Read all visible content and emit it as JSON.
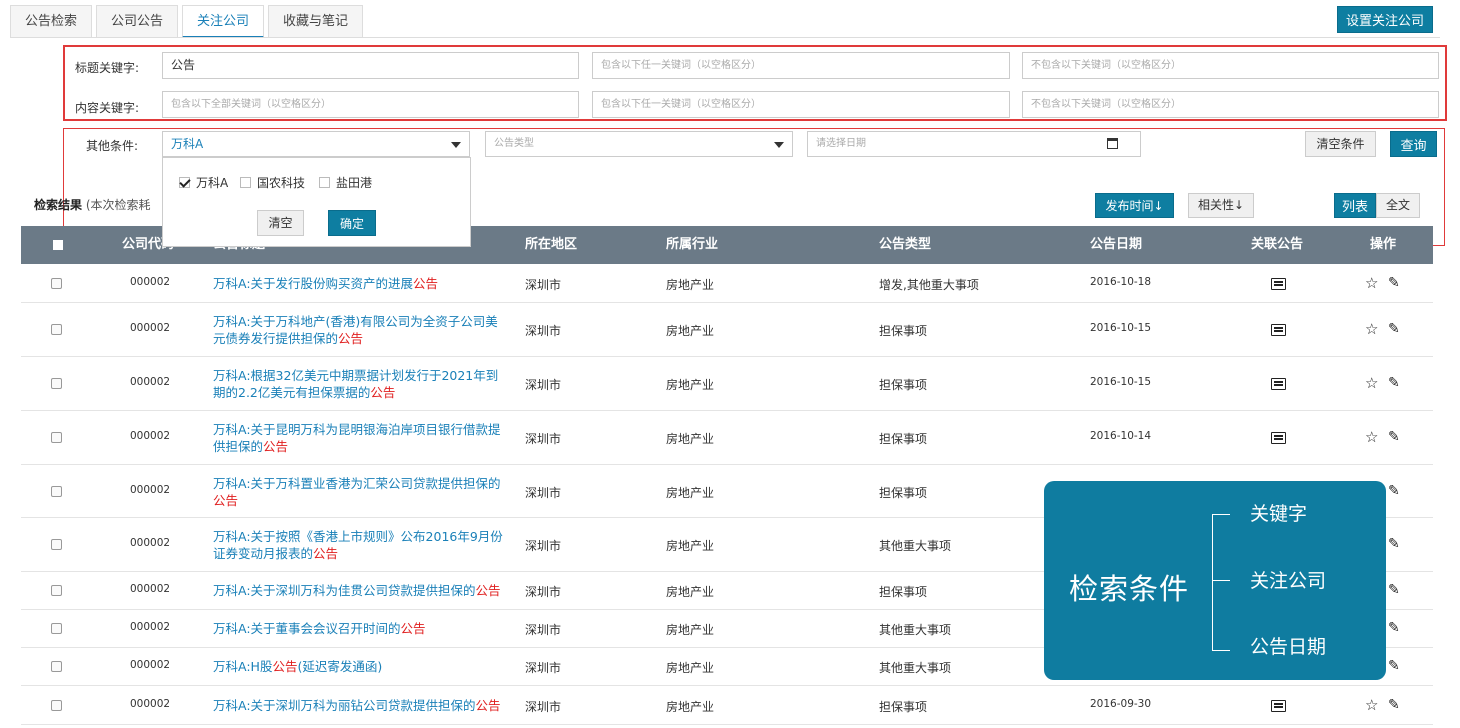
{
  "tabs": [
    "公告检索",
    "公司公告",
    "关注公司",
    "收藏与笔记"
  ],
  "setup_button": "设置关注公司",
  "keywords": {
    "title_label": "标题关键字:",
    "content_label": "内容关键字:",
    "title_all_value": "公告",
    "content_all_placeholder": "包含以下全部关键词（以空格区分）",
    "any_placeholder": "包含以下任一关键词（以空格区分）",
    "none_placeholder": "不包含以下关键词（以空格区分）"
  },
  "conditions": {
    "label": "其他条件:",
    "company_selected": "万科A",
    "type_placeholder": "公告类型",
    "date_placeholder": "请选择日期",
    "clear_button": "清空条件",
    "query_button": "查询"
  },
  "dropdown": {
    "options": [
      {
        "label": "万科A",
        "checked": true
      },
      {
        "label": "国农科技",
        "checked": false
      },
      {
        "label": "盐田港",
        "checked": false
      }
    ],
    "clear": "清空",
    "ok": "确定"
  },
  "results": {
    "title": "检索结果",
    "subtitle": "(本次检索耗",
    "sort_pub": "发布时间↓",
    "sort_rel": "相关性↓",
    "view_list": "列表",
    "view_full": "全文"
  },
  "columns": [
    "公司代码",
    "公告标题",
    "所在地区",
    "所属行业",
    "公告类型",
    "公告日期",
    "关联公告",
    "操作"
  ],
  "rows": [
    {
      "code": "000002",
      "title": "万科A:关于发行股份购买资产的进展",
      "hl": "公告",
      "region": "深圳市",
      "industry": "房地产业",
      "type": "增发,其他重大事项",
      "date": "2016-10-18"
    },
    {
      "code": "000002",
      "title": "万科A:关于万科地产(香港)有限公司为全资子公司美元债券发行提供担保的",
      "hl": "公告",
      "region": "深圳市",
      "industry": "房地产业",
      "type": "担保事项",
      "date": "2016-10-15"
    },
    {
      "code": "000002",
      "title": "万科A:根据32亿美元中期票据计划发行于2021年到期的2.2亿美元有担保票据的",
      "hl": "公告",
      "region": "深圳市",
      "industry": "房地产业",
      "type": "担保事项",
      "date": "2016-10-15"
    },
    {
      "code": "000002",
      "title": "万科A:关于昆明万科为昆明银海泊岸项目银行借款提供担保的",
      "hl": "公告",
      "region": "深圳市",
      "industry": "房地产业",
      "type": "担保事项",
      "date": "2016-10-14"
    },
    {
      "code": "000002",
      "title": "万科A:关于万科置业香港为汇荣公司贷款提供担保的",
      "hl": "公告",
      "region": "深圳市",
      "industry": "房地产业",
      "type": "担保事项",
      "date": ""
    },
    {
      "code": "000002",
      "title": "万科A:关于按照《香港上市规则》公布2016年9月份证券变动月报表的",
      "hl": "公告",
      "region": "深圳市",
      "industry": "房地产业",
      "type": "其他重大事项",
      "date": ""
    },
    {
      "code": "000002",
      "title": "万科A:关于深圳万科为佳贯公司贷款提供担保的",
      "hl": "公告",
      "region": "深圳市",
      "industry": "房地产业",
      "type": "担保事项",
      "date": ""
    },
    {
      "code": "000002",
      "title": "万科A:关于董事会会议召开时间的",
      "hl": "公告",
      "region": "深圳市",
      "industry": "房地产业",
      "type": "其他重大事项",
      "date": ""
    },
    {
      "code": "000002",
      "title": "万科A:H股",
      "hl": "公告",
      "suffix": "(延迟寄发通函)",
      "region": "深圳市",
      "industry": "房地产业",
      "type": "其他重大事项",
      "date": ""
    },
    {
      "code": "000002",
      "title": "万科A:关于深圳万科为丽钻公司贷款提供担保的",
      "hl": "公告",
      "region": "深圳市",
      "industry": "房地产业",
      "type": "担保事项",
      "date": "2016-09-30"
    }
  ],
  "overlay": {
    "main": "检索条件",
    "items": [
      "关键字",
      "关注公司",
      "公告日期"
    ]
  }
}
